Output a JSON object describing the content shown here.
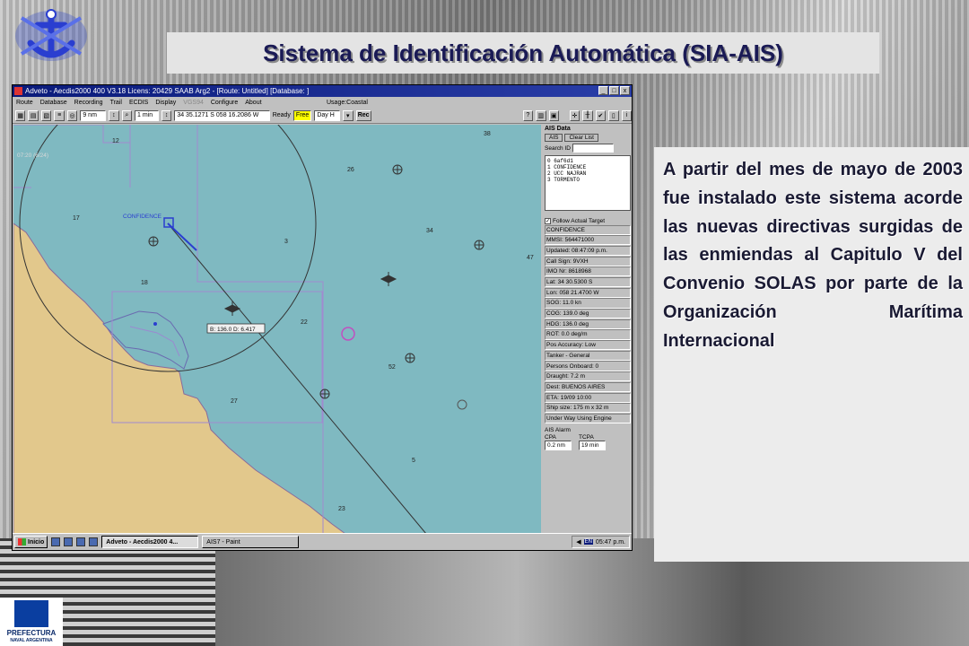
{
  "slide": {
    "title": "Sistema de Identificación Automática (SIA-AIS)",
    "body_text": "A partir del mes de mayo de 2003 fue instalado este sistema acorde las nuevas directivas surgidas de las enmiendas al Capitulo V del Convenio SOLAS por parte de la Organización Marítima Internacional",
    "logo_name": "PREFECTURA",
    "logo_subtitle": "NAVAL ARGENTINA"
  },
  "app": {
    "window_title": "Adveto - Aecdis2000 400 V3.18  Licens: 20429 SAAB Arg2 - [Route: Untitled] [Database: ]",
    "menus": [
      "Route",
      "Database",
      "Recording",
      "Trail",
      "ECDIS",
      "Display",
      "VGS94",
      "Configure",
      "About"
    ],
    "usage": "Usage:Coastal",
    "toolbar": {
      "range": "9 nm",
      "interval": "1 min",
      "position": "34 35.1271 S  058 16.2086 W",
      "status": "Ready",
      "mode": "Free",
      "display": "Day H",
      "rec": "Rec"
    },
    "window_buttons": [
      "_",
      "□",
      "x"
    ]
  },
  "map": {
    "target_label": "CONFIDENCE",
    "bearing_box": "B: 136.0 D: 6.417",
    "corner_label": "07:20 (6/24)",
    "soundings": [
      "12",
      "38",
      "26",
      "17",
      "3",
      "34",
      "47",
      "18",
      "22",
      "52",
      "27",
      "5",
      "23"
    ]
  },
  "ais_panel": {
    "header": "AIS Data",
    "tab_ais": "AIS",
    "clear_list": "Clear List",
    "search_label": "Search ID",
    "list": [
      "0   6af6d1",
      "1 CONFIDENCE",
      "2 UCC NAJRAN",
      "3 TORMENTO"
    ],
    "follow_label": "Follow Actual Target",
    "follow_checked": "✓",
    "details": [
      "CONFIDENCE",
      "MMSI: 564471000",
      "Updated: 08:47:09 p.m.",
      "Call Sign: 9VXH",
      "IMO Nr: 8618968",
      "Lat: 34 30.5300 S",
      "Lon: 058 21.4700 W",
      "SOG: 11.0 kn",
      "COG: 139.0 deg",
      "HDG: 136.0 deg",
      "ROT: 0.0 deg/m",
      "Pos Accuracy: Low",
      "Tanker - General",
      "Persons Onboard: 0",
      "Draught: 7.2 m",
      "Dest: BUENOS AIRES",
      "ETA: 19/09 10:00",
      "Ship size: 175 m x 32 m",
      "Under Way Using Engine"
    ],
    "alarm_label": "AIS Alarm",
    "cpa_label": "CPA",
    "cpa_value": "0.2 nm",
    "tcpa_label": "TCPA",
    "tcpa_value": "19 min"
  },
  "taskbar": {
    "start": "Inicio",
    "tasks": [
      "Adveto - Aecdis2000 4...",
      "AIS7 - Paint"
    ],
    "lang": "EN",
    "clock": "05:47 p.m."
  }
}
